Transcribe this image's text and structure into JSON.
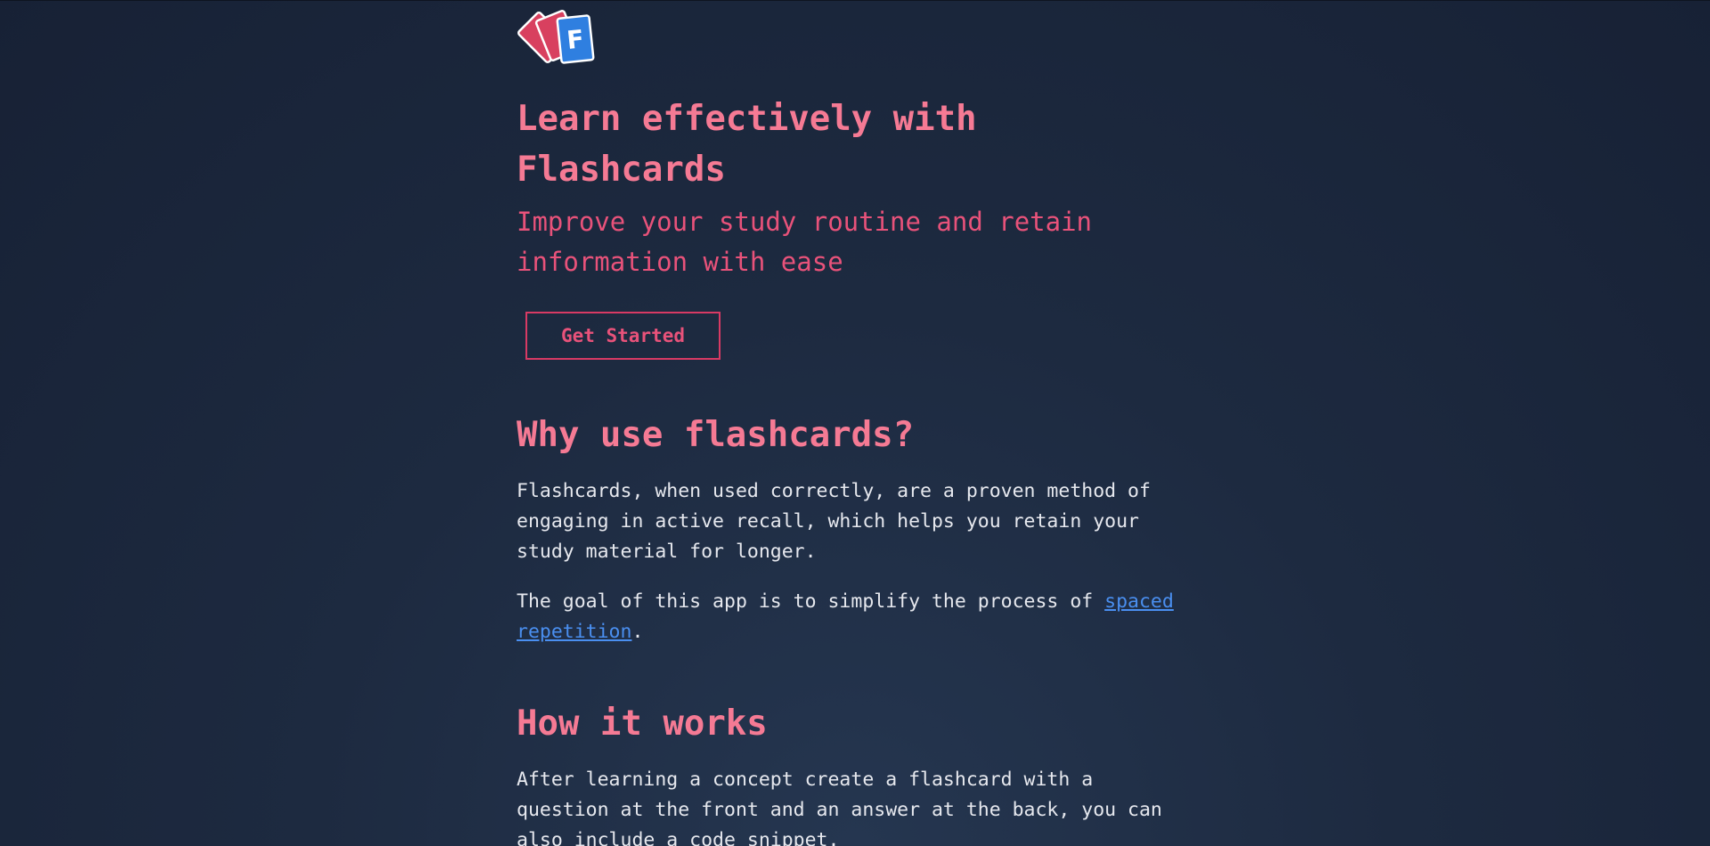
{
  "hero": {
    "title": "Learn effectively with Flashcards",
    "subtitle": "Improve your study routine and retain information with ease",
    "cta_label": "Get Started",
    "logo_letter": "F"
  },
  "why": {
    "heading": "Why use flashcards?",
    "paragraph1": "Flashcards, when used correctly, are a proven method of engaging in active recall, which helps you retain your study material for longer.",
    "paragraph2_prefix": "The goal of this app is to simplify the process of ",
    "paragraph2_link": "spaced repetition",
    "paragraph2_suffix": "."
  },
  "how": {
    "heading": "How it works",
    "paragraph1": "After learning a concept create a flashcard with a question at the front and an answer at the back, you can also include a code snippet."
  },
  "colors": {
    "background": "#1d2a40",
    "accent_pink": "#f57a94",
    "accent_red": "#d83a64",
    "link_blue": "#4a8ff0",
    "logo_blue": "#2f7fe0"
  },
  "icons": {
    "logo": "flashcards-logo-icon"
  }
}
